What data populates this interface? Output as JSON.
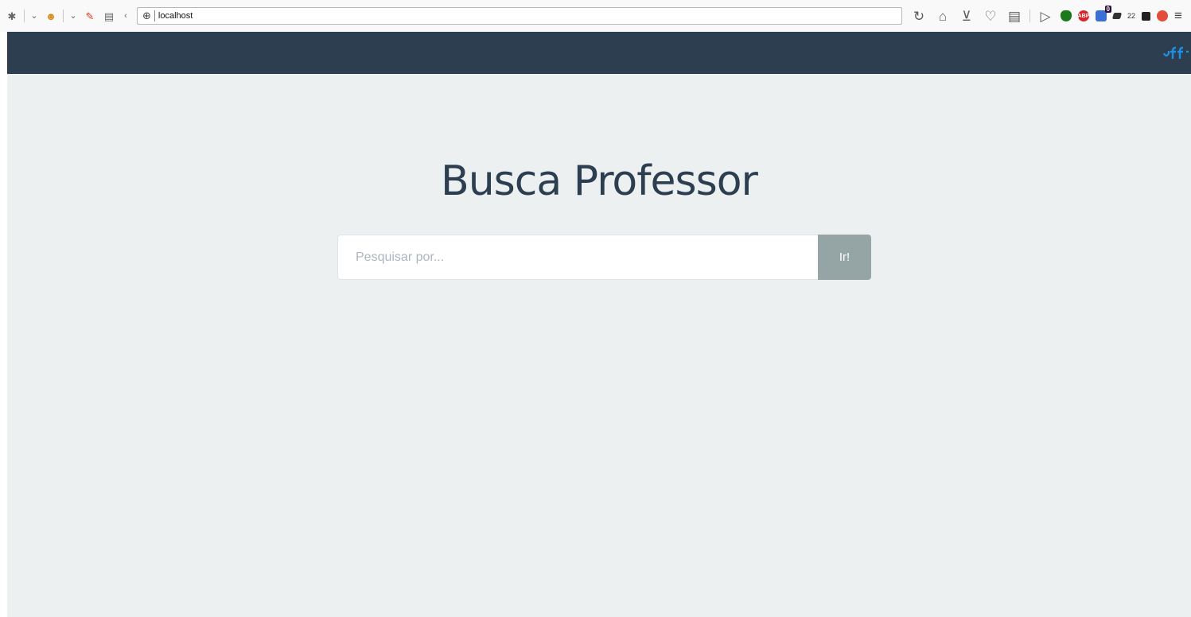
{
  "browser": {
    "url": "localhost",
    "extension_count": "22",
    "extension_badge": "0",
    "icons": {
      "puzzle": "extension-icon",
      "reload": "reload-icon",
      "home": "home-icon",
      "download": "download-icon",
      "heart": "pocket-icon",
      "reader": "reader-icon",
      "send": "send-icon",
      "shield": "shield-extension-icon",
      "abp": "adblock-icon",
      "menu": "hamburger-menu-icon"
    },
    "abp_label": "ABP"
  },
  "navbar": {
    "brand_color": "#2c3e50",
    "logo_color": "#1f8fe0"
  },
  "main": {
    "title": "Busca Professor",
    "search_placeholder": "Pesquisar por...",
    "search_button_label": "Ir!"
  },
  "colors": {
    "page_background": "#ecf0f1",
    "title_color": "#2c3e50",
    "button_color": "#95a5a6"
  }
}
